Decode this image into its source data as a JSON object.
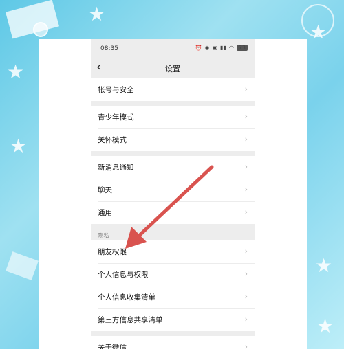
{
  "status_bar": {
    "time": "08:35",
    "battery": "73"
  },
  "navbar": {
    "title": "设置"
  },
  "groups": [
    {
      "items": [
        "帐号与安全"
      ]
    },
    {
      "items": [
        "青少年模式",
        "关怀模式"
      ]
    },
    {
      "items": [
        "新消息通知",
        "聊天",
        "通用"
      ]
    },
    {
      "header": "隐私",
      "items": [
        "朋友权限",
        "个人信息与权限",
        "个人信息收集清单",
        "第三方信息共享清单"
      ]
    },
    {
      "items": [
        "关于微信"
      ]
    }
  ],
  "icons": {
    "chevron": "chevron-right-icon",
    "back": "back-arrow-icon"
  },
  "annotation": {
    "color": "#d9534f",
    "points_to": "朋友权限"
  }
}
